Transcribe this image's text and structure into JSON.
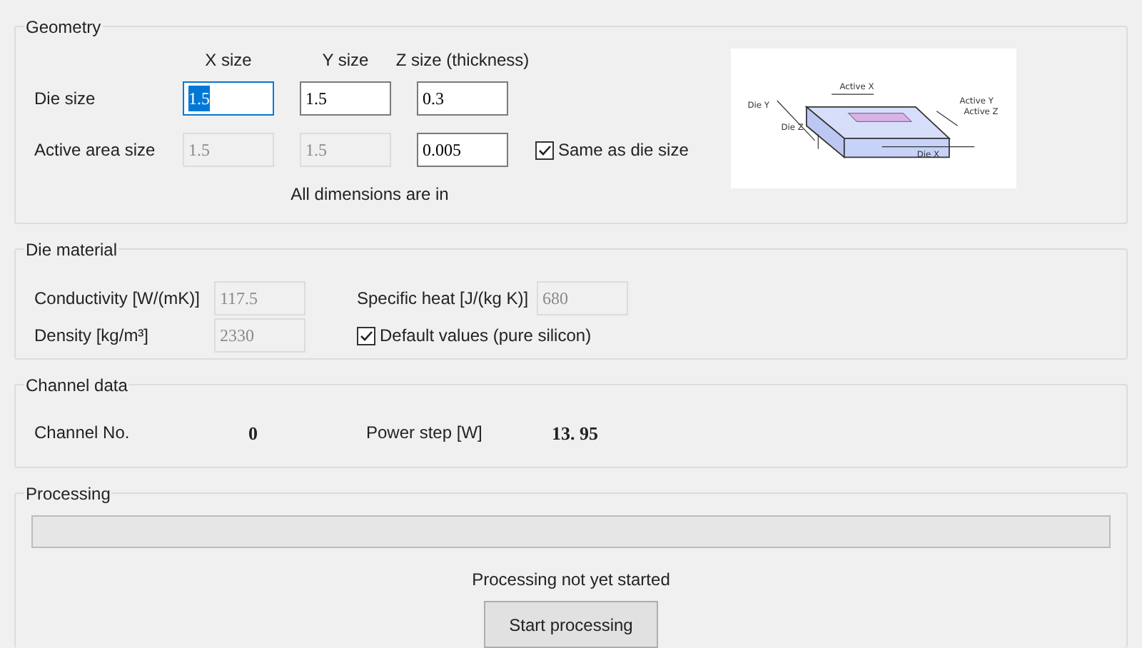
{
  "geometry": {
    "title": "Geometry",
    "columns": [
      "X size",
      "Y size",
      "Z size (thickness)"
    ],
    "rows": [
      {
        "label": "Die size",
        "fields": [
          {
            "value": "1.5",
            "disabled": false,
            "selected": true
          },
          {
            "value": "1.5",
            "disabled": false,
            "selected": false
          },
          {
            "value": "0.3",
            "disabled": false,
            "selected": false
          }
        ]
      },
      {
        "label": "Active area size",
        "fields": [
          {
            "value": "1.5",
            "disabled": true,
            "selected": false
          },
          {
            "value": "1.5",
            "disabled": true,
            "selected": false
          },
          {
            "value": "0.005",
            "disabled": false,
            "selected": false
          }
        ],
        "checkbox": {
          "label": "Same as die size",
          "checked": true
        }
      }
    ],
    "note": "All dimensions are in",
    "diagram_labels": [
      "Active X",
      "Active Y",
      "Active Z",
      "Die Y",
      "Die Z",
      "Die X"
    ]
  },
  "die_material": {
    "title": "Die material",
    "fields": [
      {
        "label": "Conductivity [W/(mK)]",
        "value": "117.5",
        "disabled": true
      },
      {
        "label": "Specific heat [J/(kg K)]",
        "value": "680",
        "disabled": true
      },
      {
        "label": "Density [kg/m³]",
        "value": "2330",
        "disabled": true
      }
    ],
    "checkbox": {
      "label": "Default values (pure silicon)",
      "checked": true
    }
  },
  "channel_data": {
    "title": "Channel data",
    "items": [
      {
        "label": "Channel No.",
        "value": "0"
      },
      {
        "label": "Power step [W]",
        "value": "13. 95"
      }
    ]
  },
  "processing": {
    "title": "Processing",
    "progress": {
      "level": 0
    },
    "status": "Processing not yet started",
    "button": "Start processing"
  }
}
